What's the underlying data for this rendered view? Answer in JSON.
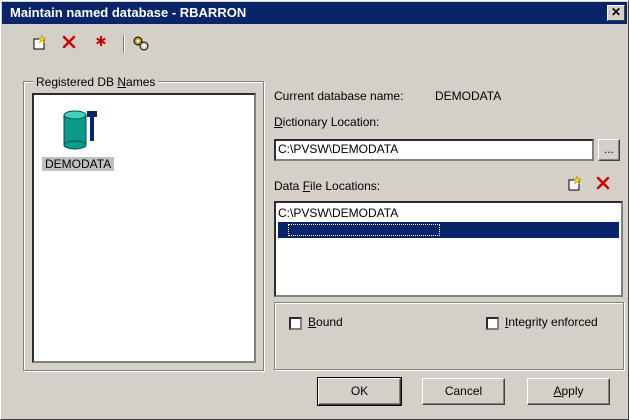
{
  "window": {
    "title": "Maintain named database - RBARRON",
    "close_glyph": "✕"
  },
  "toolbar": {
    "new_icon": "new-icon",
    "delete_icon": "delete-icon",
    "required_icon": "asterisk-icon",
    "settings_icon": "gears-icon"
  },
  "registered": {
    "group_label_pre": "Registered DB ",
    "group_label_ul": "N",
    "group_label_post": "ames",
    "items": [
      {
        "label": "DEMODATA",
        "icon": "database-icon"
      }
    ]
  },
  "details": {
    "current_db_label": "Current database name:",
    "current_db_value": "DEMODATA",
    "dict_label_ul": "D",
    "dict_label_rest": "ictionary Location:",
    "dict_value": "C:\\PVSW\\DEMODATA",
    "browse_label": "...",
    "datafile_label_pre": "Data ",
    "datafile_label_ul": "F",
    "datafile_label_post": "ile Locations:",
    "datafile_items": [
      "C:\\PVSW\\DEMODATA",
      ""
    ]
  },
  "options": {
    "bound_ul": "B",
    "bound_rest": "ound",
    "bound_checked": false,
    "integrity_ul": "I",
    "integrity_rest": "ntegrity enforced",
    "integrity_checked": false
  },
  "buttons": {
    "ok": "OK",
    "cancel": "Cancel",
    "apply_ul": "A",
    "apply_rest": "pply"
  },
  "colors": {
    "titlebar": "#0a246a",
    "selection": "#0a246a",
    "face": "#d4d0c8",
    "delete_red": "#cc0000"
  }
}
